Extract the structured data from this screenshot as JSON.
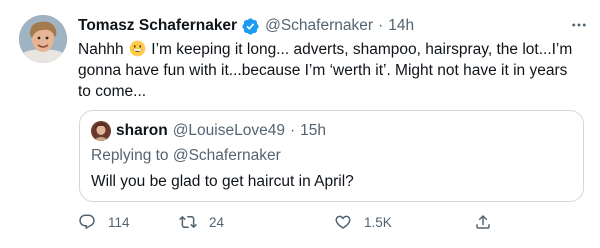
{
  "tweet": {
    "author_name": "Tomasz Schafernaker",
    "author_handle": "@Schafernaker",
    "separator": "·",
    "time": "14h",
    "text_before_emoji": "Nahhh ",
    "emoji": "grinning-face",
    "text_after_emoji": " I’m keeping it long... adverts, shampoo, hairspray, the lot...I’m gonna have fun with it...because I’m ‘werth it’. Might not have it in years to come...",
    "verified_color": "#1d9bf0"
  },
  "quoted_tweet": {
    "author_name": "sharon",
    "author_handle": "@LouiseLove49",
    "separator": "·",
    "time": "15h",
    "replying_prefix": "Replying to ",
    "replying_to": "@Schafernaker",
    "text": "Will you be glad to get haircut in April?"
  },
  "actions": {
    "reply_count": "114",
    "retweet_count": "24",
    "like_count": "1.5K"
  },
  "colors": {
    "text": "#0f1419",
    "secondary": "#536471",
    "border": "#cfd9de"
  },
  "icons": [
    "more-options-icon",
    "verified-badge-icon",
    "reply-icon",
    "retweet-icon",
    "like-icon",
    "share-icon"
  ]
}
